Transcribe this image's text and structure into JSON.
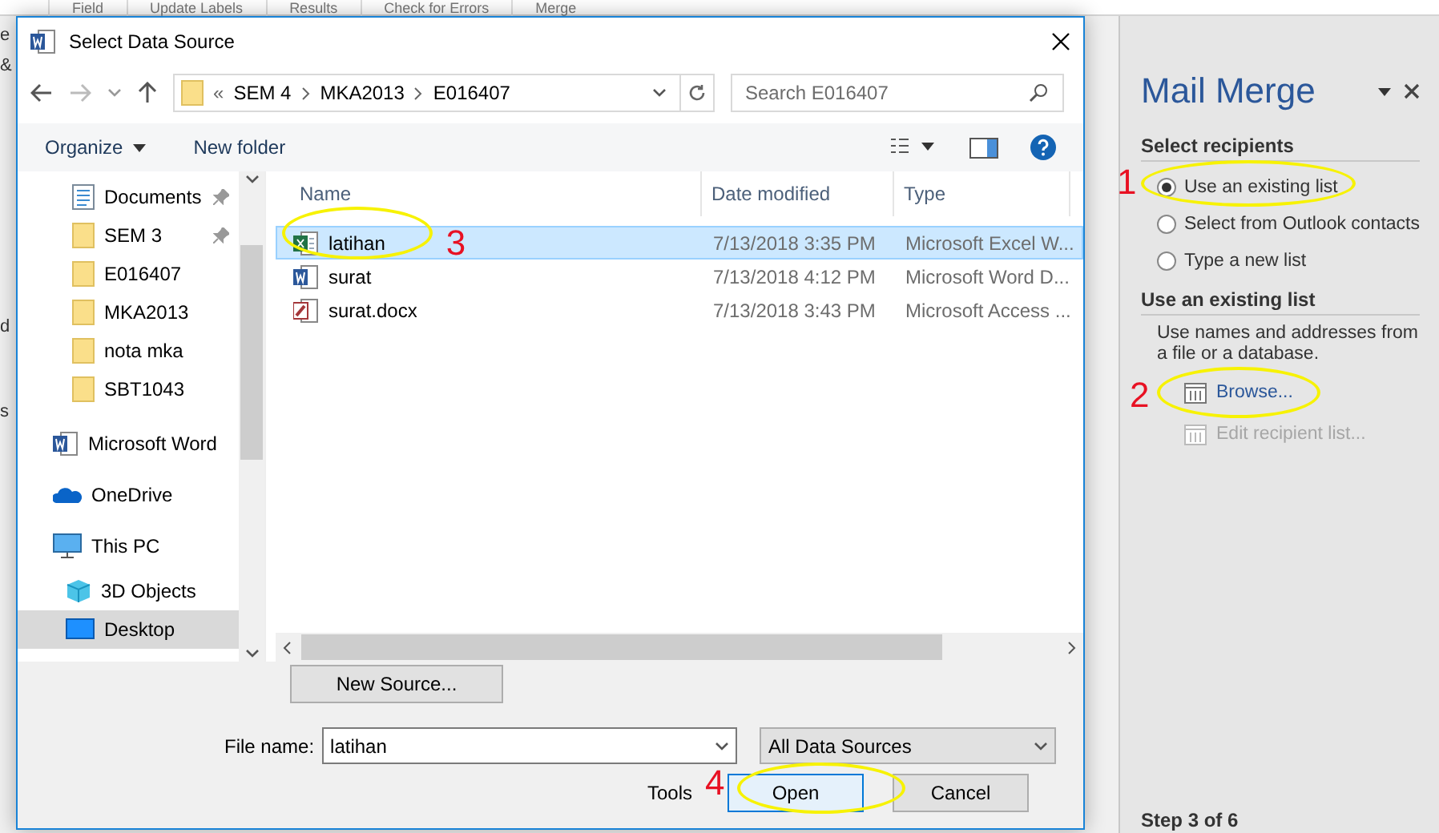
{
  "ribbon": {
    "labels": [
      "Field",
      "Update Labels",
      "Results",
      "Check for Errors",
      "Merge"
    ]
  },
  "document": {
    "fragments": [
      "e",
      "&",
      "d",
      "s"
    ]
  },
  "dialog": {
    "title": "Select Data Source",
    "address": {
      "overflow": "«",
      "crumbs": [
        "SEM 4",
        "MKA2013",
        "E016407"
      ]
    },
    "search": {
      "placeholder": "Search E016407"
    },
    "toolbar": {
      "organize": "Organize",
      "new_folder": "New folder"
    },
    "quick_access": [
      {
        "label": "Documents",
        "kind": "document",
        "pinned": true,
        "selected": false
      },
      {
        "label": "SEM 3",
        "kind": "folder",
        "pinned": true,
        "selected": false
      },
      {
        "label": "E016407",
        "kind": "folder",
        "pinned": false,
        "selected": false
      },
      {
        "label": "MKA2013",
        "kind": "folder",
        "pinned": false,
        "selected": false
      },
      {
        "label": "nota mka",
        "kind": "folder",
        "pinned": false,
        "selected": false
      },
      {
        "label": "SBT1043",
        "kind": "folder",
        "pinned": false,
        "selected": false
      }
    ],
    "locations": [
      {
        "label": "Microsoft Word",
        "kind": "word",
        "selected": false
      },
      {
        "label": "OneDrive",
        "kind": "cloud",
        "selected": false
      },
      {
        "label": "This PC",
        "kind": "pc",
        "selected": false,
        "children": [
          {
            "label": "3D Objects",
            "kind": "cube",
            "selected": false
          },
          {
            "label": "Desktop",
            "kind": "desktop",
            "selected": true
          }
        ]
      }
    ],
    "columns": [
      "Name",
      "Date modified",
      "Type"
    ],
    "files": [
      {
        "name": "latihan",
        "kind": "excel",
        "date": "7/13/2018 3:35 PM",
        "type": "Microsoft Excel W...",
        "selected": true,
        "callout": "3"
      },
      {
        "name": "surat",
        "kind": "word",
        "date": "7/13/2018 4:12 PM",
        "type": "Microsoft Word D...",
        "selected": false
      },
      {
        "name": "surat.docx",
        "kind": "access",
        "date": "7/13/2018 3:43 PM",
        "type": "Microsoft Access ...",
        "selected": false
      }
    ],
    "new_source": "New Source...",
    "file_name_label": "File name:",
    "file_name": "latihan",
    "filter": "All Data Sources",
    "tools": "Tools",
    "open": "Open",
    "cancel": "Cancel"
  },
  "mail_merge": {
    "title": "Mail Merge",
    "section_1": "Select recipients",
    "options": [
      {
        "label": "Use an existing list",
        "selected": true
      },
      {
        "label": "Select from Outlook contacts",
        "selected": false
      },
      {
        "label": "Type a new list",
        "selected": false
      }
    ],
    "section_2": "Use an existing list",
    "description": "Use names and addresses from a file or a database.",
    "links": [
      {
        "label": "Browse...",
        "disabled": false
      },
      {
        "label": "Edit recipient list...",
        "disabled": true
      }
    ],
    "step": "Step 3 of 6"
  },
  "annotations": [
    {
      "number": "1"
    },
    {
      "number": "2"
    },
    {
      "number": "4"
    }
  ]
}
